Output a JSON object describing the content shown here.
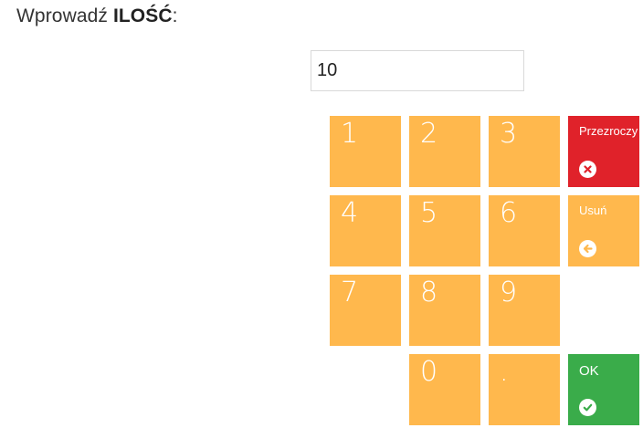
{
  "prompt": {
    "prefix": "Wprowadź ",
    "emphasis": "ILOŚĆ",
    "suffix": ":"
  },
  "input": {
    "value": "10"
  },
  "keypad": {
    "keys": [
      "1",
      "2",
      "3",
      "4",
      "5",
      "6",
      "7",
      "8",
      "9",
      "0",
      "."
    ],
    "clear_label": "Przezroczy",
    "backspace_label": "Usuń",
    "ok_label": "OK"
  },
  "colors": {
    "key": "#ffb84d",
    "clear": "#e0222a",
    "ok": "#3aac4a"
  },
  "icons": {
    "clear": "close-circle-icon",
    "backspace": "arrow-left-circle-icon",
    "ok": "check-circle-icon"
  }
}
